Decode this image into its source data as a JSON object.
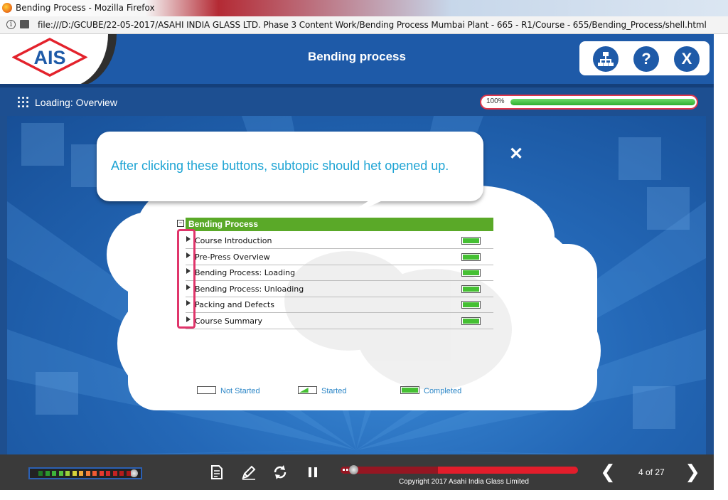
{
  "browser": {
    "window_title": "Bending Process - Mozilla Firefox",
    "url": "file:///D:/GCUBE/22-05-2017/ASAHI INDIA GLASS LTD. Phase 3 Content Work/Bending Process  Mumbai Plant - 665 - R1/Course - 655/Bending_Process/shell.html"
  },
  "header": {
    "logo_text": "AIS",
    "title": "Bending process",
    "buttons": {
      "sitemap_icon": "sitemap-icon",
      "help_label": "?",
      "exit_label": "X"
    }
  },
  "subheader": {
    "menu_icon": "grid-menu-icon",
    "location": "Loading: Overview",
    "progress_label": "100%",
    "progress_fraction": 1.0
  },
  "callout": {
    "text": "After clicking these buttons, subtopic should het opened up.",
    "close_label": "✕"
  },
  "menu": {
    "title": "Bending Process",
    "collapse_label": "−",
    "items": [
      {
        "label": "Course Introduction",
        "status": "completed"
      },
      {
        "label": "Pre-Press Overview",
        "status": "completed"
      },
      {
        "label": "Bending Process: Loading",
        "status": "completed"
      },
      {
        "label": "Bending Process: Unloading",
        "status": "completed"
      },
      {
        "label": "Packing and Defects",
        "status": "completed"
      },
      {
        "label": "Course Summary",
        "status": "completed"
      }
    ]
  },
  "legend": {
    "not_started": "Not Started",
    "started": "Started",
    "completed": "Completed"
  },
  "player": {
    "copyright": "Copyright 2017 Asahi India Glass Limited",
    "page_indicator": "4 of 27",
    "prev_label": "❮",
    "next_label": "❯",
    "seek_fraction": 0.41,
    "colors": {
      "header_blue": "#1e5aa8",
      "menu_green": "#5aa928",
      "status_green": "#45c033",
      "seek_red": "#e21d2b",
      "highlight_pink": "#e0356b",
      "callout_text": "#1ea4d4"
    }
  }
}
